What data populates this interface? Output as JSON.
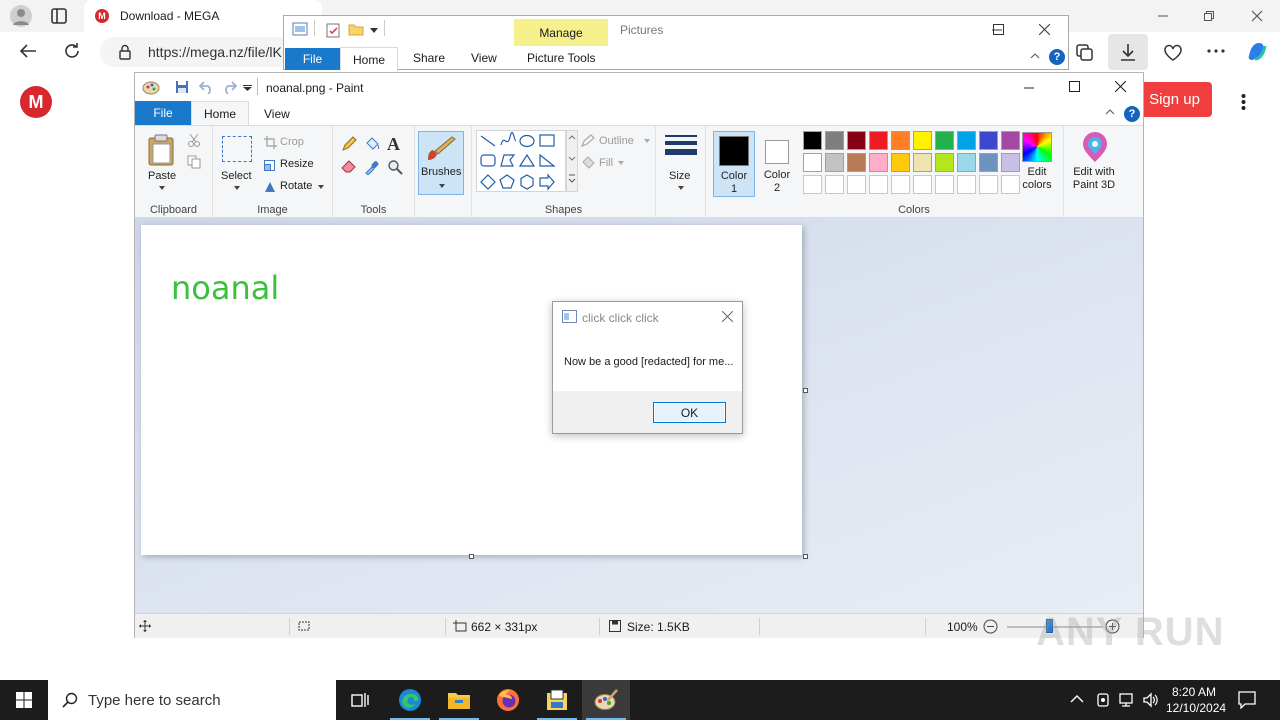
{
  "browser": {
    "tab_title": "Download - MEGA",
    "address": "https://mega.nz/file/lK",
    "signup_label": "Sign up"
  },
  "explorer": {
    "file_tab": "File",
    "home_tab": "Home",
    "share_tab": "Share",
    "view_tab": "View",
    "manage_label": "Manage",
    "picture_tools_label": "Picture Tools",
    "title": "Pictures"
  },
  "paint": {
    "title": "noanal.png - Paint",
    "tabs": {
      "file": "File",
      "home": "Home",
      "view": "View"
    },
    "clipboard": {
      "paste": "Paste",
      "group": "Clipboard"
    },
    "image": {
      "select": "Select",
      "crop": "Crop",
      "resize": "Resize",
      "rotate": "Rotate",
      "group": "Image"
    },
    "tools": {
      "group": "Tools"
    },
    "brushes": "Brushes",
    "shapes": {
      "outline": "Outline",
      "fill": "Fill",
      "group": "Shapes"
    },
    "size_label": "Size",
    "color1": [
      "Color",
      "1"
    ],
    "color2": [
      "Color",
      "2"
    ],
    "colors_group": "Colors",
    "edit_colors": [
      "Edit",
      "colors"
    ],
    "edit_paint3d": [
      "Edit with",
      "Paint 3D"
    ],
    "palette_row1": [
      "#000000",
      "#7f7f7f",
      "#880015",
      "#ed1c24",
      "#ff7f27",
      "#fff200",
      "#22b14c",
      "#00a2e8",
      "#3f48cc",
      "#a349a4"
    ],
    "palette_row2": [
      "#ffffff",
      "#c3c3c3",
      "#b97a57",
      "#ffaec9",
      "#ffc90e",
      "#efe4b0",
      "#b5e61d",
      "#99d9ea",
      "#7092be",
      "#c8bfe7"
    ],
    "canvas_text": "noanal",
    "canvas_text_color": "#3bc13b",
    "status": {
      "dimensions": "662 × 331px",
      "size": "Size: 1.5KB",
      "zoom": "100%"
    }
  },
  "dialog": {
    "title": "click click click",
    "message": "Now be a good [redacted] for me...",
    "ok": "OK"
  },
  "taskbar": {
    "search_placeholder": "Type here to search",
    "time": "8:20 AM",
    "date": "12/10/2024"
  },
  "watermark": "ANY RUN"
}
